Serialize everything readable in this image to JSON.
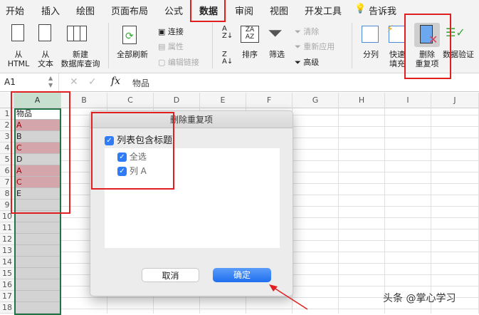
{
  "tabs": [
    "开始",
    "插入",
    "绘图",
    "页面布局",
    "公式",
    "数据",
    "审阅",
    "视图",
    "开发工具",
    "告诉我"
  ],
  "active_tab": "数据",
  "ribbon": {
    "from_html": [
      "从",
      "HTML"
    ],
    "from_text": [
      "从",
      "文本"
    ],
    "new_query": [
      "新建",
      "数据库查询"
    ],
    "refresh_all": "全部刷新",
    "connections": "连接",
    "properties": "属性",
    "edit_links": "编辑链接",
    "sort": "排序",
    "filter": "筛选",
    "clear": "清除",
    "reapply": "重新应用",
    "advanced": "高级",
    "text_to_columns": "分列",
    "flash_fill": [
      "快速",
      "填充"
    ],
    "remove_duplicates": [
      "删除",
      "重复项"
    ],
    "data_validation": "数据验证"
  },
  "formula_bar": {
    "name_box": "A1",
    "fx": "fx",
    "value": "物品"
  },
  "columns": [
    "A",
    "B",
    "C",
    "D",
    "E",
    "F",
    "G",
    "H",
    "I",
    "J"
  ],
  "rows": [
    "1",
    "2",
    "3",
    "4",
    "5",
    "6",
    "7",
    "8",
    "9",
    "10",
    "11",
    "12",
    "13",
    "14",
    "15",
    "16",
    "17",
    "18"
  ],
  "cells": [
    "物品",
    "A",
    "B",
    "C",
    "D",
    "A",
    "C",
    "E"
  ],
  "duplicate_rows": [
    2,
    4,
    6,
    7
  ],
  "dialog": {
    "title": "删除重复项",
    "header_checkbox": "列表包含标题",
    "select_all": "全选",
    "col_a": "列 A",
    "cancel": "取消",
    "ok": "确定"
  },
  "watermark": "头条 @掌心学习",
  "colors": {
    "accent": "#217346",
    "highlight": "#e02020",
    "dup_fill": "#d4a5aa",
    "button": "#2f7cf6"
  }
}
